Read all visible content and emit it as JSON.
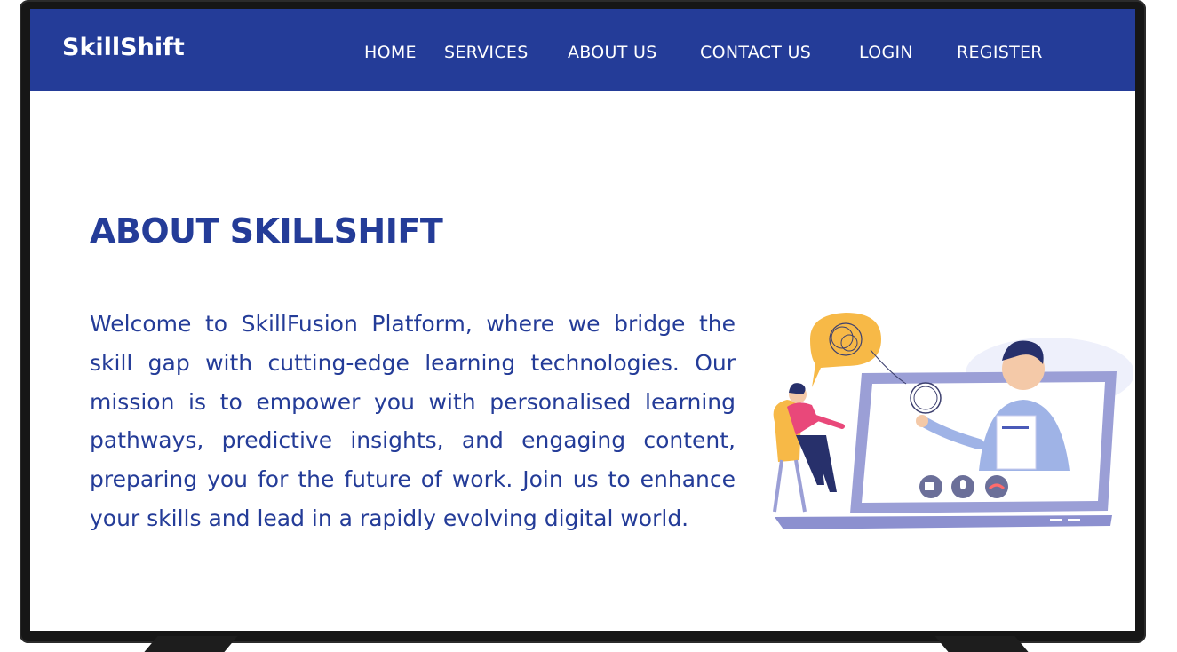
{
  "brand": "SkillShift",
  "nav": {
    "home": "HOME",
    "services": "SERVICES",
    "about": "ABOUT US",
    "contact": "CONTACT US",
    "login": "LOGIN",
    "register": "REGISTER"
  },
  "about": {
    "title": "ABOUT SKILLSHIFT",
    "body": "Welcome to SkillFusion Platform, where we bridge the skill gap with cutting-edge learning technologies. Our mission is to empower you with personalised learning pathways, predictive insights, and engaging content, preparing you for the future of work. Join us to enhance your skills and lead in a rapidly evolving digital world."
  },
  "colors": {
    "primary": "#243c98",
    "illustration_purple": "#9b9fd6",
    "speech_bubble": "#f7b947",
    "woman_top": "#e9487a"
  },
  "icons": [
    "video-camera-icon",
    "microphone-icon",
    "hang-up-icon"
  ]
}
